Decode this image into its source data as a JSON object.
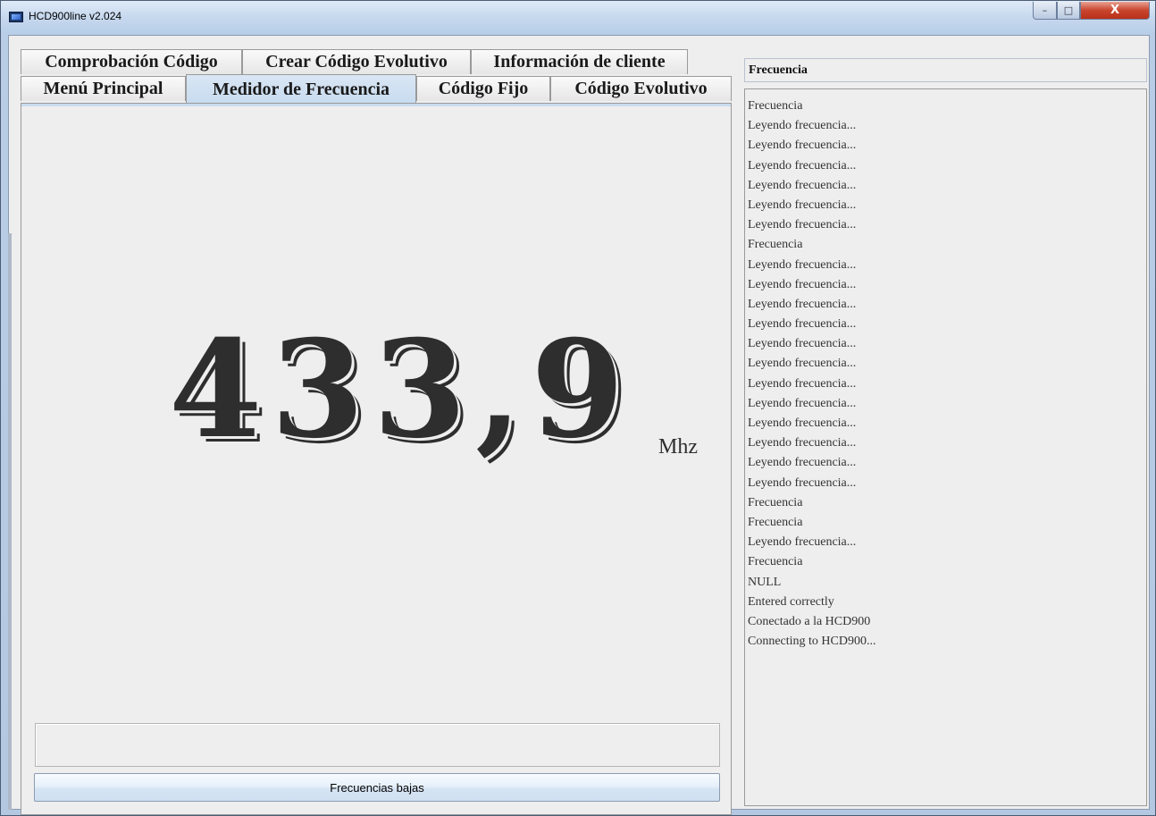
{
  "window": {
    "title": "HCD900line  v2.024",
    "controls": {
      "minimize": "–",
      "maximize": "□",
      "close": "X"
    }
  },
  "tabs": {
    "row1": [
      "Comprobación Código",
      "Crear Código Evolutivo",
      "Información de cliente"
    ],
    "row2": [
      "Menú Principal",
      "Medidor de Frecuencia",
      "Código Fijo",
      "Código Evolutivo"
    ],
    "selected": "Medidor de Frecuencia"
  },
  "frequency": {
    "value": "433,9",
    "unit": "Mhz"
  },
  "status_field": {
    "value": ""
  },
  "button": {
    "label": "Frecuencias bajas"
  },
  "log": {
    "header": "Frecuencia",
    "lines": [
      "Frecuencia",
      "Leyendo frecuencia...",
      "Leyendo frecuencia...",
      "Leyendo frecuencia...",
      "Leyendo frecuencia...",
      "Leyendo frecuencia...",
      "Leyendo frecuencia...",
      "Frecuencia",
      "Leyendo frecuencia...",
      "Leyendo frecuencia...",
      "Leyendo frecuencia...",
      "Leyendo frecuencia...",
      "Leyendo frecuencia...",
      "Leyendo frecuencia...",
      "Leyendo frecuencia...",
      "Leyendo frecuencia...",
      "Leyendo frecuencia...",
      "Leyendo frecuencia...",
      "Leyendo frecuencia...",
      "Leyendo frecuencia...",
      "Frecuencia",
      "Frecuencia",
      "Leyendo frecuencia...",
      "Frecuencia",
      "NULL",
      "Entered correctly",
      "Conectado a la HCD900",
      "Connecting to HCD900..."
    ]
  },
  "colors": {
    "accent_selected_tab": "#c8dbef",
    "digits": "#2e2e2e",
    "close_button": "#c9452d"
  }
}
